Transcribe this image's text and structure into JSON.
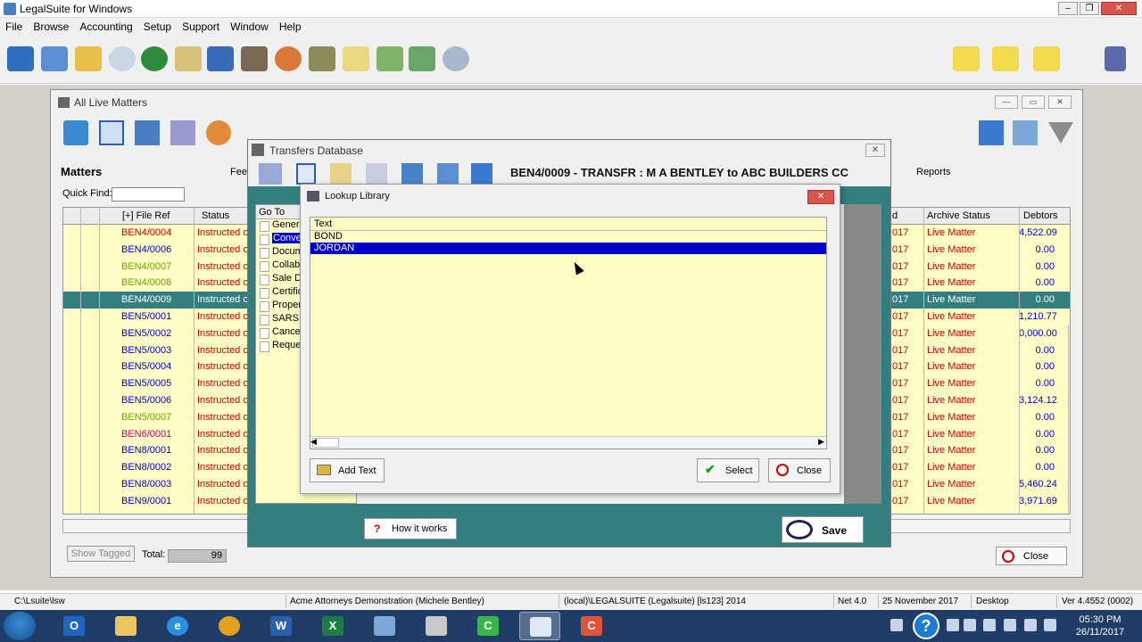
{
  "app": {
    "title": "LegalSuite for Windows",
    "menu": [
      "File",
      "Browse",
      "Accounting",
      "Setup",
      "Support",
      "Window",
      "Help"
    ]
  },
  "matters_window": {
    "title": "All Live Matters",
    "matters_label": "Matters",
    "quick_find_label": "Quick Find:",
    "quick_find_value": "",
    "fee_label": "Fee",
    "reports_label": "Reports",
    "columns": [
      "[+] File Ref",
      "Status",
      "d",
      "Archive Status",
      "Debtors"
    ],
    "rows": [
      {
        "ref": "BEN4/0004",
        "status": "Instructed or",
        "d": "017",
        "archive": "Live Matter",
        "debtors": "4,522.09",
        "color": "#cc0000"
      },
      {
        "ref": "BEN4/0006",
        "status": "Instructed or",
        "d": "017",
        "archive": "Live Matter",
        "debtors": "0.00",
        "color": "#0000cc"
      },
      {
        "ref": "BEN4/0007",
        "status": "Instructed or",
        "d": "017",
        "archive": "Live Matter",
        "debtors": "0.00",
        "color": "#6aa800"
      },
      {
        "ref": "BEN4/0008",
        "status": "Instructed or",
        "d": "017",
        "archive": "Live Matter",
        "debtors": "0.00",
        "color": "#6aa800"
      },
      {
        "ref": "BEN4/0009",
        "status": "Instructed or",
        "d": "017",
        "archive": "Live Matter",
        "debtors": "0.00",
        "color": "#ffffff"
      },
      {
        "ref": "BEN5/0001",
        "status": "Instructed or",
        "d": "017",
        "archive": "Live Matter",
        "debtors": "1,210.77",
        "color": "#0000cc"
      },
      {
        "ref": "BEN5/0002",
        "status": "Instructed or",
        "d": "017",
        "archive": "Live Matter",
        "debtors": "0,000.00",
        "color": "#0000cc"
      },
      {
        "ref": "BEN5/0003",
        "status": "Instructed or",
        "d": "017",
        "archive": "Live Matter",
        "debtors": "0.00",
        "color": "#0000cc"
      },
      {
        "ref": "BEN5/0004",
        "status": "Instructed or",
        "d": "017",
        "archive": "Live Matter",
        "debtors": "0.00",
        "color": "#0000cc"
      },
      {
        "ref": "BEN5/0005",
        "status": "Instructed or",
        "d": "017",
        "archive": "Live Matter",
        "debtors": "0.00",
        "color": "#0000cc"
      },
      {
        "ref": "BEN5/0006",
        "status": "Instructed or",
        "d": "017",
        "archive": "Live Matter",
        "debtors": "3,124.12",
        "color": "#0000cc"
      },
      {
        "ref": "BEN5/0007",
        "status": "Instructed or",
        "d": "017",
        "archive": "Live Matter",
        "debtors": "0.00",
        "color": "#6aa800"
      },
      {
        "ref": "BEN6/0001",
        "status": "Instructed or",
        "d": "017",
        "archive": "Live Matter",
        "debtors": "0.00",
        "color": "#cc0066"
      },
      {
        "ref": "BEN8/0001",
        "status": "Instructed or",
        "d": "017",
        "archive": "Live Matter",
        "debtors": "0.00",
        "color": "#0000cc"
      },
      {
        "ref": "BEN8/0002",
        "status": "Instructed or",
        "d": "017",
        "archive": "Live Matter",
        "debtors": "0.00",
        "color": "#0000cc"
      },
      {
        "ref": "BEN8/0003",
        "status": "Instructed or",
        "d": "017",
        "archive": "Live Matter",
        "debtors": "5,460.24",
        "color": "#0000cc"
      },
      {
        "ref": "BEN9/0001",
        "status": "Instructed or",
        "d": "017",
        "archive": "Live Matter",
        "debtors": "3,971.69",
        "color": "#0000cc"
      }
    ],
    "selected_row": 4,
    "show_tagged_label": "Show Tagged",
    "total_label": "Total:",
    "total_value": "99",
    "close_label": "Close"
  },
  "transfers_window": {
    "title": "Transfers Database",
    "heading": "BEN4/0009 - TRANSFR : M A BENTLEY to ABC BUILDERS CC",
    "goto_header": "Go To",
    "goto_items": [
      "General",
      "Conveyancing",
      "Documents",
      "Collaboration",
      "Sale Details",
      "Certificates",
      "Property",
      "SARS",
      "Cancellation",
      "Requests"
    ],
    "goto_selected": 1,
    "how_it_works_label": "How it works",
    "save_label": "Save"
  },
  "lookup_dialog": {
    "title": "Lookup Library",
    "column_header": "Text",
    "items": [
      "BOND",
      "JORDAN"
    ],
    "selected_index": 1,
    "add_text_label": "Add Text",
    "select_label": "Select",
    "close_label": "Close"
  },
  "status_bar": [
    "C:\\Lsuite\\lsw",
    "Acme Attorneys Demonstration (Michele Bentley)",
    "(local)\\LEGALSUITE (Legalsuite) [ls123] 2014",
    "Net 4.0",
    "25 November 2017",
    "Desktop",
    "Ver 4.4552 (0002)"
  ],
  "taskbar": {
    "time": "05:30 PM",
    "date": "26/11/2017"
  }
}
